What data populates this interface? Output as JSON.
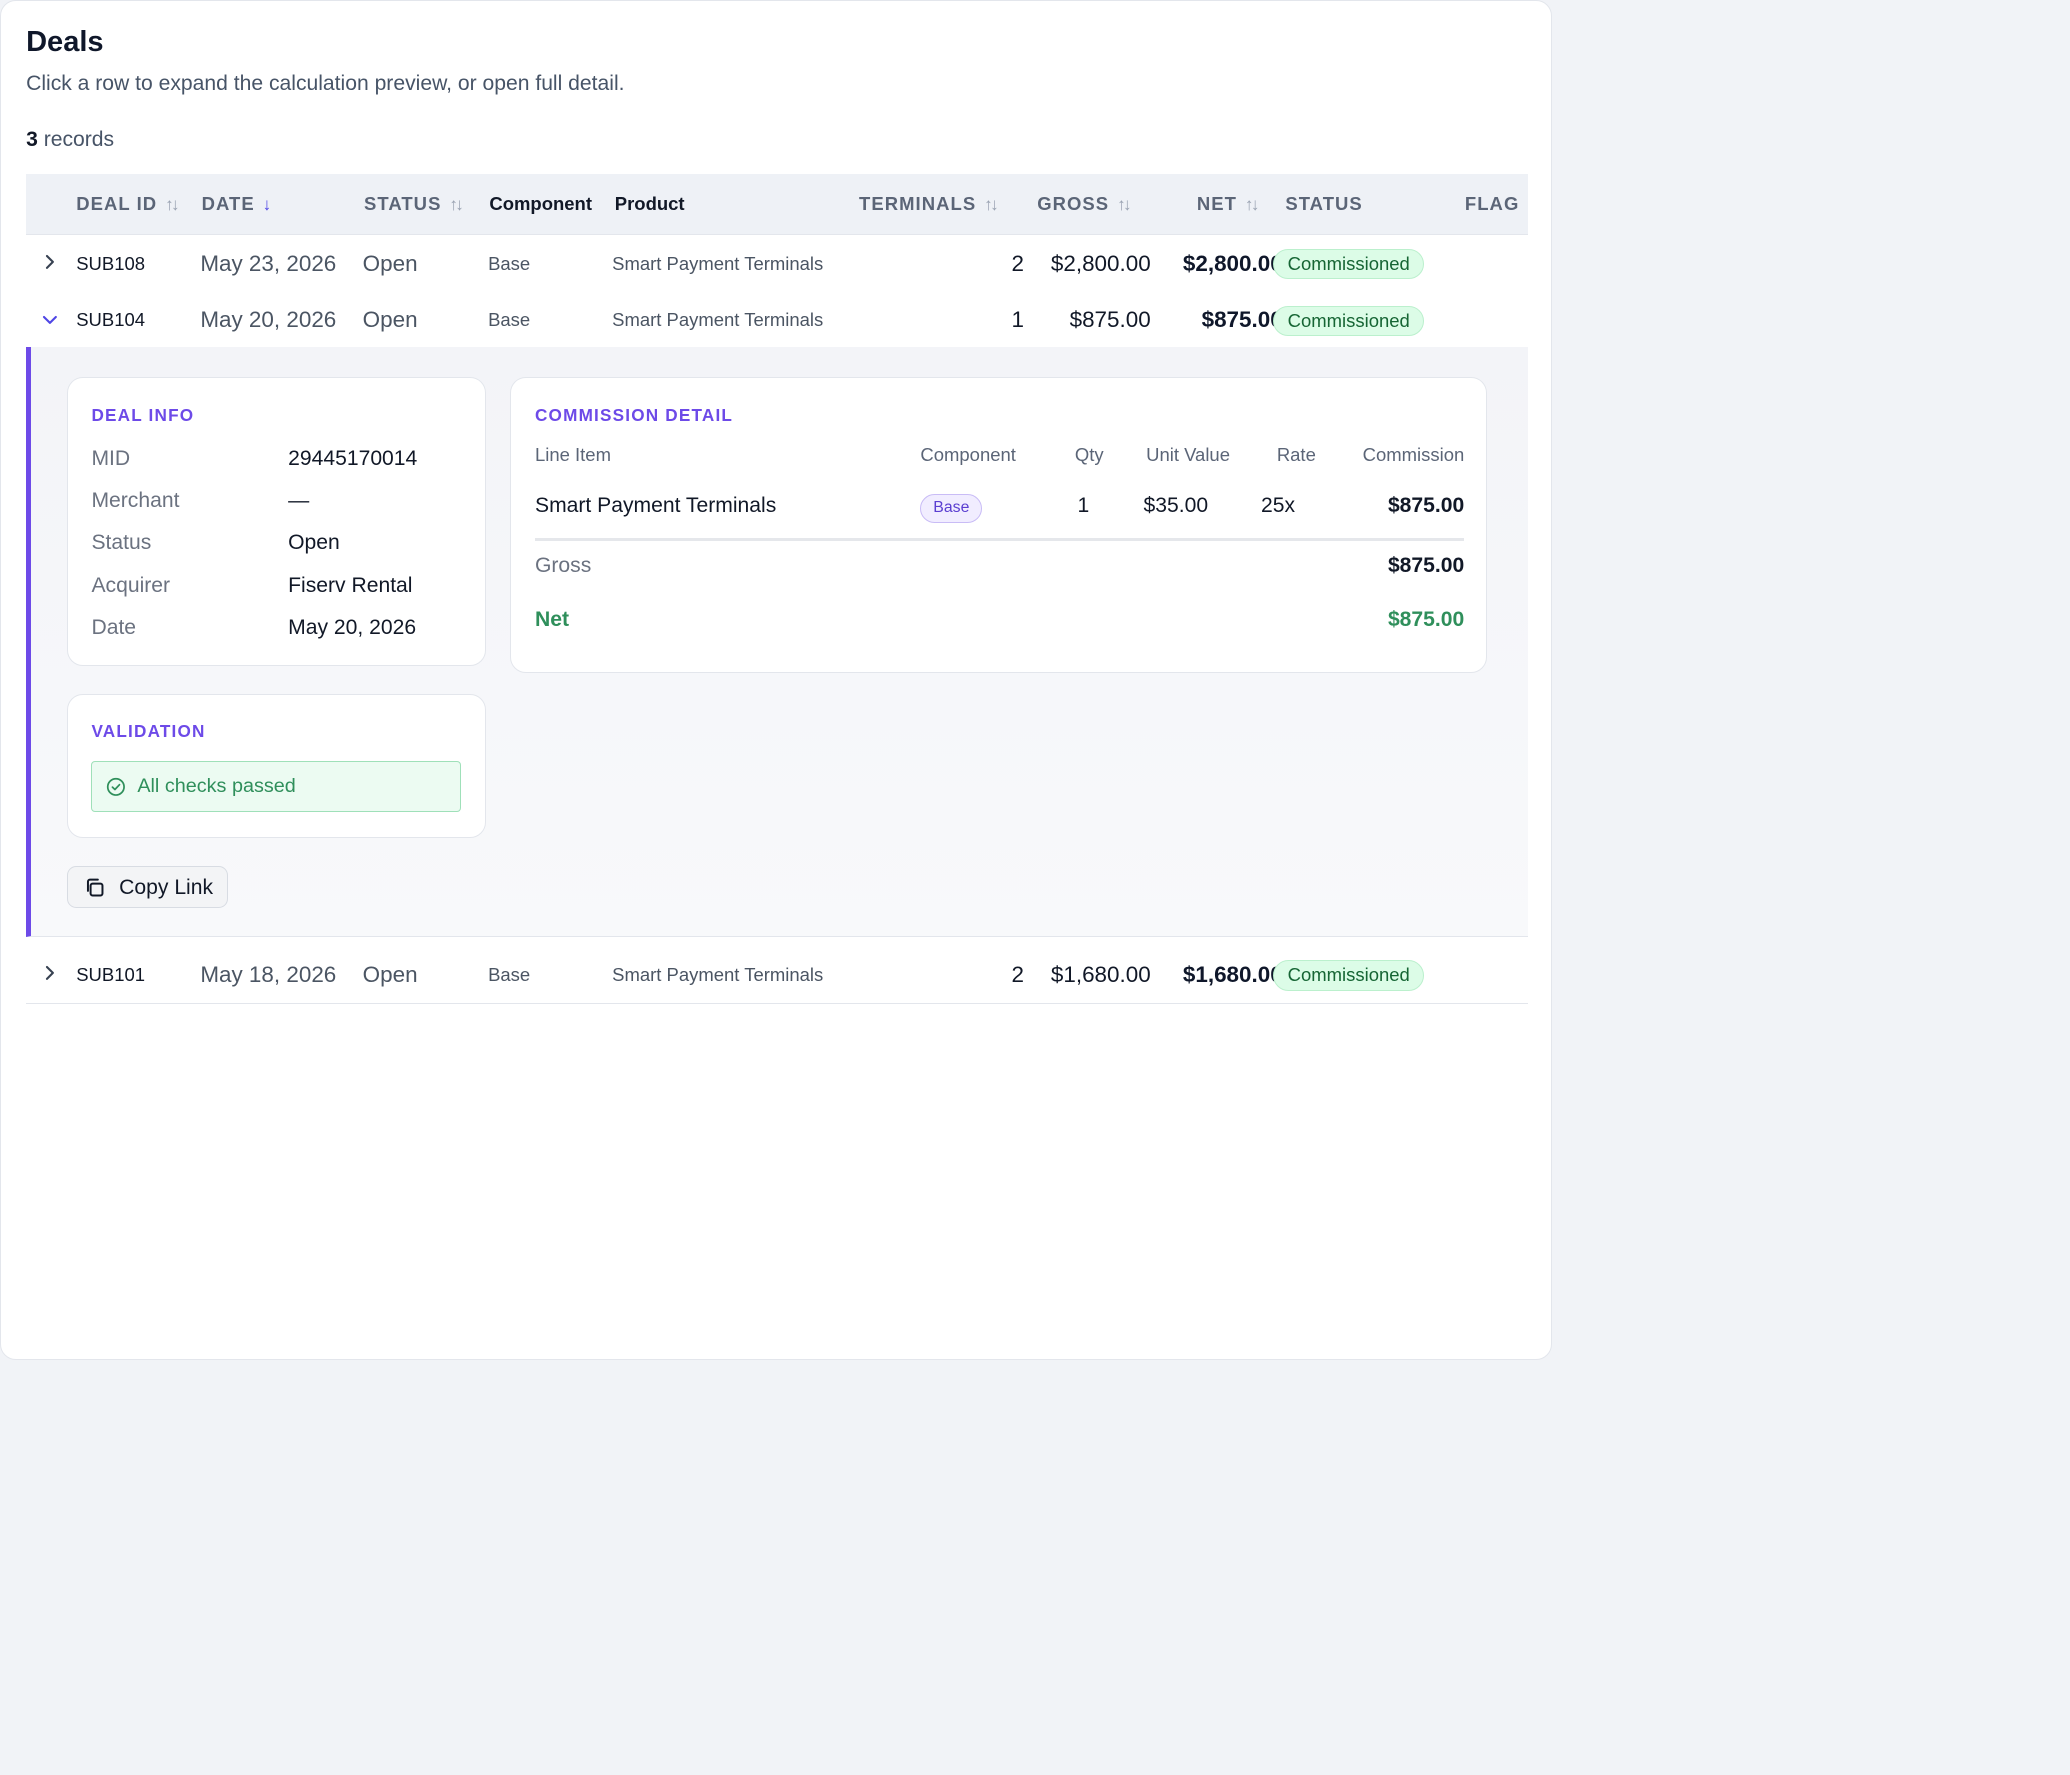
{
  "page": {
    "title": "Deals",
    "subtitle": "Click a row to expand the calculation preview, or open full detail.",
    "record_count": "3",
    "record_suffix": "records"
  },
  "table": {
    "headers": {
      "deal_id": "DEAL ID",
      "date": "DATE",
      "status": "STATUS",
      "component": "Component",
      "product": "Product",
      "terminals": "TERMINALS",
      "gross": "GROSS",
      "net": "NET",
      "status2": "STATUS",
      "flag": "FLAG"
    },
    "rows": [
      {
        "id": "SUB108",
        "date": "May 23, 2026",
        "status": "Open",
        "component": "Base",
        "product": "Smart Payment Terminals",
        "terminals": "2",
        "gross": "$2,800.00",
        "net": "$2,800.00",
        "badge": "Commissioned"
      },
      {
        "id": "SUB104",
        "date": "May 20, 2026",
        "status": "Open",
        "component": "Base",
        "product": "Smart Payment Terminals",
        "terminals": "1",
        "gross": "$875.00",
        "net": "$875.00",
        "badge": "Commissioned"
      },
      {
        "id": "SUB101",
        "date": "May 18, 2026",
        "status": "Open",
        "component": "Base",
        "product": "Smart Payment Terminals",
        "terminals": "2",
        "gross": "$1,680.00",
        "net": "$1,680.00",
        "badge": "Commissioned"
      }
    ]
  },
  "detail": {
    "deal_info": {
      "title": "DEAL INFO",
      "fields": [
        {
          "label": "MID",
          "value": "29445170014"
        },
        {
          "label": "Merchant",
          "value": "—"
        },
        {
          "label": "Status",
          "value": "Open"
        },
        {
          "label": "Acquirer",
          "value": "Fiserv Rental"
        },
        {
          "label": "Date",
          "value": "May 20, 2026"
        }
      ]
    },
    "commission": {
      "title": "COMMISSION DETAIL",
      "headers": {
        "line_item": "Line Item",
        "component": "Component",
        "qty": "Qty",
        "unit_value": "Unit Value",
        "rate": "Rate",
        "commission": "Commission"
      },
      "line": {
        "item": "Smart Payment Terminals",
        "component": "Base",
        "qty": "1",
        "unit_value": "$35.00",
        "rate": "25x",
        "commission": "$875.00"
      },
      "gross_label": "Gross",
      "gross_value": "$875.00",
      "net_label": "Net",
      "net_value": "$875.00"
    },
    "validation": {
      "title": "VALIDATION",
      "message": "All checks passed"
    },
    "copy_link_label": "Copy Link"
  },
  "icons": {
    "sort": "sort-icon",
    "sort_desc": "arrow-down-icon",
    "expand": "chevron-right-icon",
    "collapse": "chevron-down-icon",
    "check": "check-circle-icon",
    "copy": "copy-icon"
  },
  "colors": {
    "accent": "#6d4ae8",
    "success": "#2f8f5b",
    "badge_bg": "#dcfce7"
  }
}
